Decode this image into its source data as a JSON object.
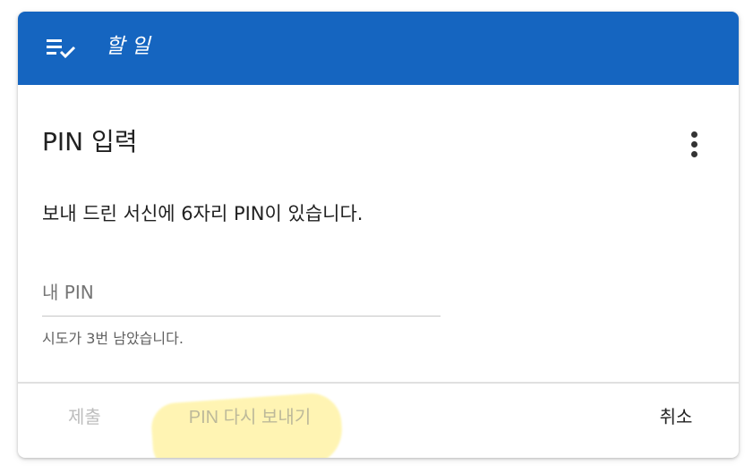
{
  "header": {
    "icon": "task-list-check-icon",
    "title": "할 일",
    "color": "#1565c0"
  },
  "dialog": {
    "title": "PIN 입력",
    "more_icon": "more-vert-icon",
    "description": "보내 드린 서신에 6자리 PIN이 있습니다.",
    "pin_field": {
      "placeholder": "내 PIN",
      "value": ""
    },
    "helper_text": "시도가 3번 남았습니다."
  },
  "actions": {
    "submit_label": "제출",
    "resend_label": "PIN 다시 보내기",
    "cancel_label": "취소",
    "highlight_color": "#fff3a6"
  }
}
